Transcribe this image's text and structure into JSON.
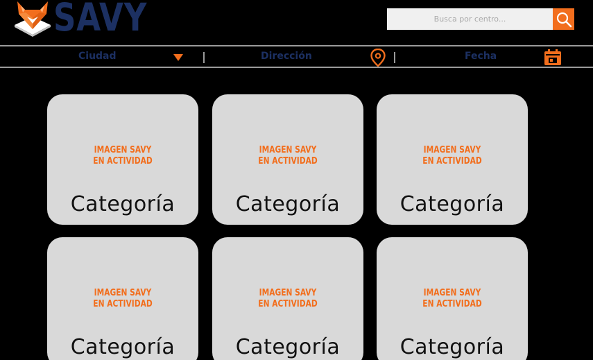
{
  "brand": {
    "name": "SAVY",
    "logo_icon": "fox-logo-icon",
    "colors": {
      "navy": "#1c3062",
      "orange": "#f26e1d",
      "card": "#d9d9d9",
      "background": "#000000"
    }
  },
  "search": {
    "placeholder": "Busca por centro...",
    "value": "",
    "button_icon": "search-icon"
  },
  "filters": [
    {
      "label": "Ciudad",
      "icon": "dropdown-triangle-icon"
    },
    {
      "label": "Dirección",
      "icon": "location-pin-icon"
    },
    {
      "label": "Fecha",
      "icon": "calendar-icon"
    }
  ],
  "cards": [
    {
      "image_line1": "IMAGEN SAVY",
      "image_line2": "EN ACTIVIDAD",
      "title": "Categoría"
    },
    {
      "image_line1": "IMAGEN SAVY",
      "image_line2": "EN ACTIVIDAD",
      "title": "Categoría"
    },
    {
      "image_line1": "IMAGEN SAVY",
      "image_line2": "EN ACTIVIDAD",
      "title": "Categoría"
    },
    {
      "image_line1": "IMAGEN SAVY",
      "image_line2": "EN ACTIVIDAD",
      "title": "Categoría"
    },
    {
      "image_line1": "IMAGEN SAVY",
      "image_line2": "EN ACTIVIDAD",
      "title": "Categoría"
    },
    {
      "image_line1": "IMAGEN SAVY",
      "image_line2": "EN ACTIVIDAD",
      "title": "Categoría"
    }
  ]
}
